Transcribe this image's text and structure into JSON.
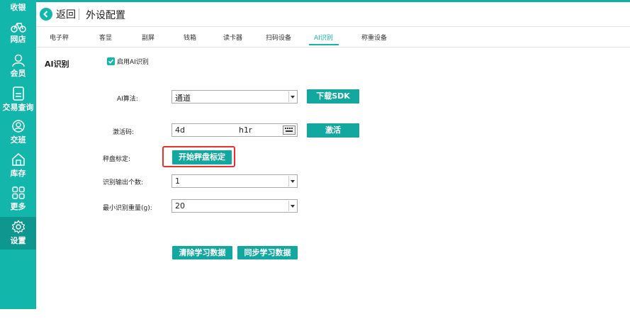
{
  "sidebar": {
    "items": [
      {
        "label": "收银",
        "icon": "cash-register-icon"
      },
      {
        "label": "网店",
        "icon": "bicycle-icon"
      },
      {
        "label": "会员",
        "icon": "user-icon"
      },
      {
        "label": "交易查询",
        "icon": "document-icon"
      },
      {
        "label": "交班",
        "icon": "shift-handover-icon"
      },
      {
        "label": "库存",
        "icon": "warehouse-icon"
      },
      {
        "label": "更多",
        "icon": "grid-icon"
      },
      {
        "label": "设置",
        "icon": "gear-icon"
      }
    ]
  },
  "header": {
    "back_label": "返回",
    "title": "外设配置"
  },
  "tabs": [
    "电子秤",
    "客显",
    "副屏",
    "钱箱",
    "读卡器",
    "扫码设备",
    "AI识别",
    "称重设备"
  ],
  "active_tab": "AI识别",
  "section": {
    "title": "AI识别",
    "enable_label": "启用AI识别",
    "enabled": true
  },
  "form": {
    "algorithm_label": "AI算法:",
    "algorithm_value": "通道",
    "download_sdk_label": "下载SDK",
    "activation_label": "激活码:",
    "activation_value": "4d",
    "activation_value_tail": "h1r",
    "activate_label": "激活",
    "calibration_label": "秤盘标定:",
    "calibration_button": "开始秤盘标定",
    "output_count_label": "识别输出个数:",
    "output_count_value": "1",
    "min_weight_label": "最小识别重量(g):",
    "min_weight_value": "20",
    "clear_data_label": "清除学习数据",
    "sync_data_label": "同步学习数据"
  },
  "colors": {
    "accent": "#12b6ab",
    "button": "#12a89f",
    "highlight": "#e8322b"
  }
}
